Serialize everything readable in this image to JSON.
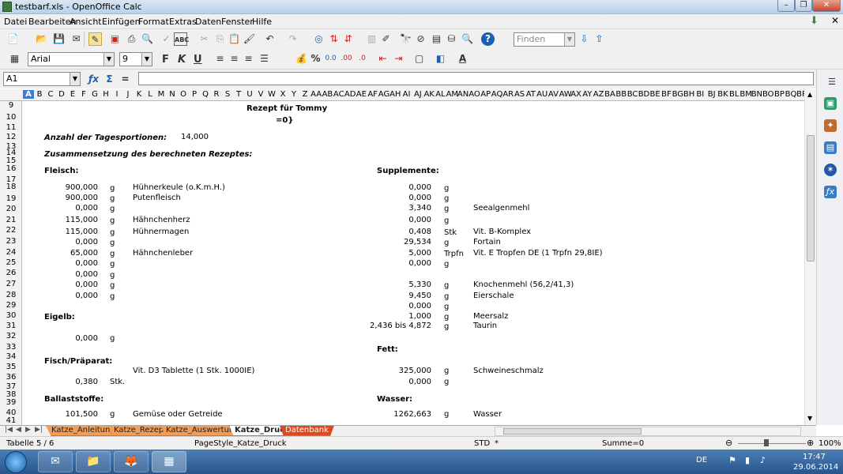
{
  "window": {
    "title": "testbarf.xls - OpenOffice Calc"
  },
  "menu": [
    "Datei",
    "Bearbeiten",
    "Ansicht",
    "Einfügen",
    "Format",
    "Extras",
    "Daten",
    "Fenster",
    "Hilfe"
  ],
  "toolbar": {
    "find_placeholder": "Finden",
    "font_name": "Arial",
    "font_size": "9"
  },
  "formula": {
    "cell_ref": "A1",
    "content": ""
  },
  "columns": [
    "A",
    "B",
    "C",
    "D",
    "E",
    "F",
    "G",
    "H",
    "I",
    "J",
    "K",
    "L",
    "M",
    "N",
    "O",
    "P",
    "Q",
    "R",
    "S",
    "T",
    "U",
    "V",
    "W",
    "X",
    "Y",
    "Z",
    "AA",
    "AB",
    "AC",
    "AD",
    "AE",
    "AF",
    "AG",
    "AH",
    "AI",
    "AJ",
    "AK",
    "AL",
    "AM",
    "AN",
    "AO",
    "AP",
    "AQ",
    "AR",
    "AS",
    "AT",
    "AU",
    "AV",
    "AW",
    "AX",
    "AY",
    "AZ",
    "BA",
    "BB",
    "BC",
    "BD",
    "BE",
    "BF",
    "BG",
    "BH",
    "BI",
    "BJ",
    "BK",
    "BL",
    "BM",
    "BN",
    "BO",
    "BP",
    "BQ",
    "BR"
  ],
  "rows": [
    "9",
    "10",
    "11",
    "12",
    "13",
    "14",
    "15",
    "16",
    "17",
    "18",
    "19",
    "20",
    "21",
    "22",
    "23",
    "24",
    "25",
    "26",
    "27",
    "28",
    "29",
    "30",
    "31",
    "32",
    "33",
    "34",
    "35",
    "36",
    "37",
    "38",
    "39",
    "40",
    "41"
  ],
  "sheet": {
    "title": "Rezept für Tommy",
    "smiley": "=0}",
    "portions_label": "Anzahl der Tagesportionen:",
    "portions_value": "14,000",
    "composition_label": "Zusammensetzung des berechneten Rezeptes:",
    "fleisch_label": "Fleisch:",
    "fleisch": [
      {
        "amount": "900,000",
        "unit": "g",
        "name": "Hühnerkeule (o.K.m.H.)"
      },
      {
        "amount": "900,000",
        "unit": "g",
        "name": "Putenfleisch"
      },
      {
        "amount": "0,000",
        "unit": "g",
        "name": ""
      },
      {
        "amount": "115,000",
        "unit": "g",
        "name": "Hähnchenherz"
      },
      {
        "amount": "115,000",
        "unit": "g",
        "name": "Hühnermagen"
      },
      {
        "amount": "0,000",
        "unit": "g",
        "name": ""
      },
      {
        "amount": "65,000",
        "unit": "g",
        "name": "Hähnchenleber"
      },
      {
        "amount": "0,000",
        "unit": "g",
        "name": ""
      },
      {
        "amount": "0,000",
        "unit": "g",
        "name": ""
      },
      {
        "amount": "0,000",
        "unit": "g",
        "name": ""
      },
      {
        "amount": "0,000",
        "unit": "g",
        "name": ""
      }
    ],
    "eigelb_label": "Eigelb:",
    "eigelb": {
      "amount": "0,000",
      "unit": "g"
    },
    "fisch_label": "Fisch/Präparat:",
    "fisch": {
      "name": "Vit. D3 Tablette (1 Stk. 1000IE)",
      "amount": "0,380",
      "unit": "Stk."
    },
    "ballast_label": "Ballaststoffe:",
    "ballast": {
      "amount": "101,500",
      "unit": "g",
      "name": "Gemüse oder Getreide"
    },
    "supplemente_label": "Supplemente:",
    "supplemente": [
      {
        "amount": "0,000",
        "unit": "g",
        "name": ""
      },
      {
        "amount": "0,000",
        "unit": "g",
        "name": ""
      },
      {
        "amount": "3,340",
        "unit": "g",
        "name": "Seealgenmehl"
      },
      {
        "amount": "0,000",
        "unit": "g",
        "name": ""
      },
      {
        "amount": "0,408",
        "unit": "Stk",
        "name": "Vit. B-Komplex"
      },
      {
        "amount": "29,534",
        "unit": "g",
        "name": "Fortain"
      },
      {
        "amount": "5,000",
        "unit": "Trpfn",
        "name": "Vit. E Tropfen DE (1 Trpfn 29,8IE)"
      },
      {
        "amount": "0,000",
        "unit": "g",
        "name": ""
      },
      {
        "amount": "5,330",
        "unit": "g",
        "name": "Knochenmehl (56,2/41,3)"
      },
      {
        "amount": "9,450",
        "unit": "g",
        "name": "Eierschale"
      },
      {
        "amount": "0,000",
        "unit": "g",
        "name": ""
      },
      {
        "amount": "1,000",
        "unit": "g",
        "name": "Meersalz"
      },
      {
        "amount": "2,436 bis 4,872",
        "unit": "g",
        "name": "Taurin"
      }
    ],
    "fett_label": "Fett:",
    "fett": [
      {
        "amount": "325,000",
        "unit": "g",
        "name": "Schweineschmalz"
      },
      {
        "amount": "0,000",
        "unit": "g",
        "name": ""
      }
    ],
    "wasser_label": "Wasser:",
    "wasser": {
      "amount": "1262,663",
      "unit": "g",
      "name": "Wasser"
    }
  },
  "tabs": [
    "Katze_Anleitung",
    "Katze_Rezept",
    "Katze_Auswertung",
    "Katze_Druck",
    "Datenbank"
  ],
  "status": {
    "sheet": "Tabelle 5 / 6",
    "page_style": "PageStyle_Katze_Druck",
    "mode": "STD",
    "modified": "*",
    "sum": "Summe=0",
    "zoom": "100%"
  },
  "taskbar": {
    "lang": "DE",
    "time": "17:47",
    "date": "29.06.2014"
  }
}
